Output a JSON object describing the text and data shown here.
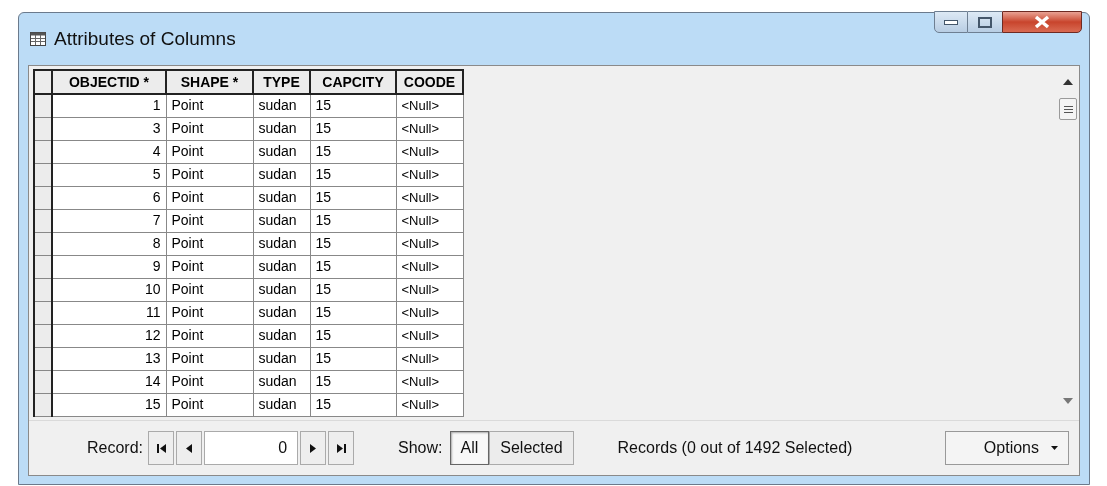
{
  "window": {
    "title": "Attributes of Columns"
  },
  "table": {
    "columns": [
      "OBJECTID *",
      "SHAPE *",
      "TYPE",
      "CAPCITY",
      "COODE"
    ],
    "rows": [
      [
        "1",
        "Point",
        "sudan",
        "15",
        "<Null>"
      ],
      [
        "3",
        "Point",
        "sudan",
        "15",
        "<Null>"
      ],
      [
        "4",
        "Point",
        "sudan",
        "15",
        "<Null>"
      ],
      [
        "5",
        "Point",
        "sudan",
        "15",
        "<Null>"
      ],
      [
        "6",
        "Point",
        "sudan",
        "15",
        "<Null>"
      ],
      [
        "7",
        "Point",
        "sudan",
        "15",
        "<Null>"
      ],
      [
        "8",
        "Point",
        "sudan",
        "15",
        "<Null>"
      ],
      [
        "9",
        "Point",
        "sudan",
        "15",
        "<Null>"
      ],
      [
        "10",
        "Point",
        "sudan",
        "15",
        "<Null>"
      ],
      [
        "11",
        "Point",
        "sudan",
        "15",
        "<Null>"
      ],
      [
        "12",
        "Point",
        "sudan",
        "15",
        "<Null>"
      ],
      [
        "13",
        "Point",
        "sudan",
        "15",
        "<Null>"
      ],
      [
        "14",
        "Point",
        "sudan",
        "15",
        "<Null>"
      ],
      [
        "15",
        "Point",
        "sudan",
        "15",
        "<Null>"
      ]
    ]
  },
  "footer": {
    "record_label": "Record:",
    "record_value": "0",
    "show_label": "Show:",
    "show_buttons": [
      {
        "label": "All",
        "selected": true
      },
      {
        "label": "Selected",
        "selected": false
      }
    ],
    "status": "Records (0 out of 1492 Selected)",
    "options_label": "Options"
  }
}
